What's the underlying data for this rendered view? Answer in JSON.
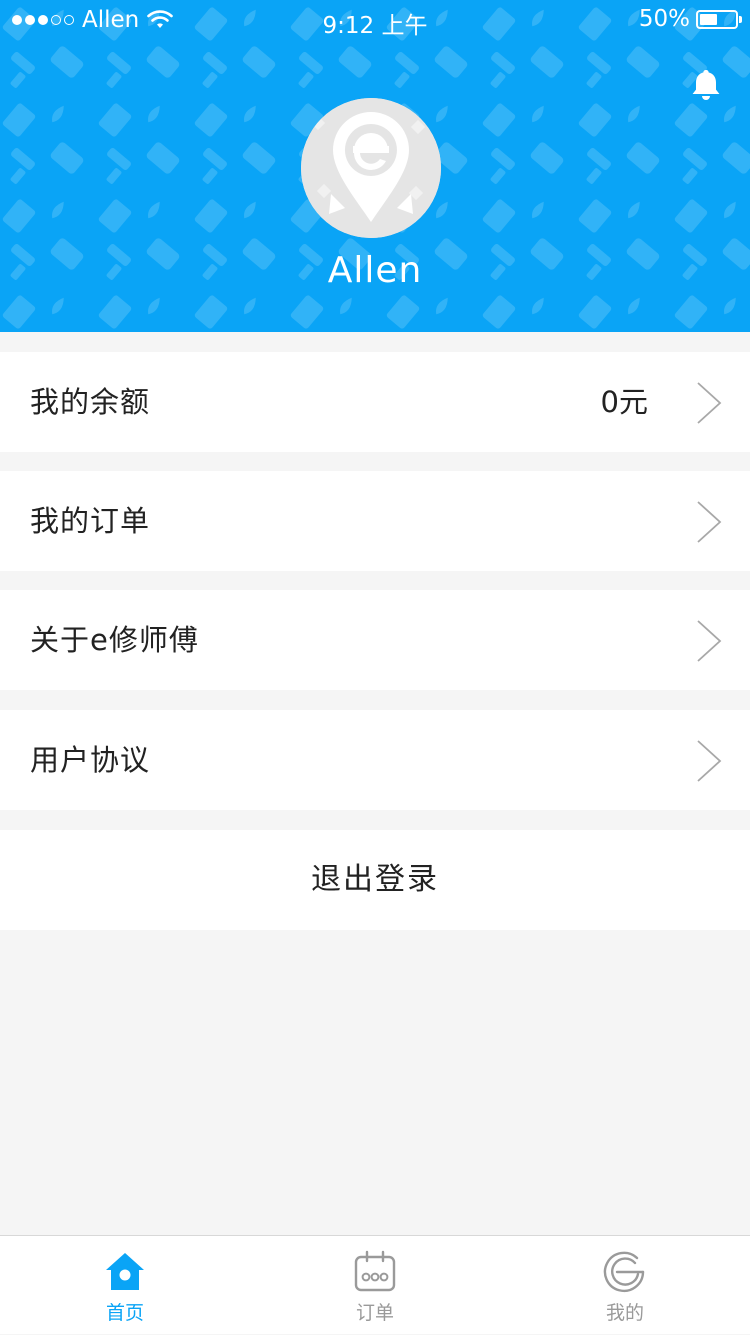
{
  "status_bar": {
    "carrier": "Allen",
    "time": "9:12 上午",
    "battery_text": "50%",
    "battery_level": 0.5
  },
  "header": {
    "username": "Allen",
    "bell_icon": "bell-icon",
    "avatar_icon": "e-map-pin-logo-icon"
  },
  "menu": {
    "items": [
      {
        "label": "我的余额",
        "value": "0元"
      },
      {
        "label": "我的订单"
      },
      {
        "label": "关于e修师傅"
      },
      {
        "label": "用户协议"
      }
    ],
    "logout_label": "退出登录"
  },
  "tabbar": {
    "tabs": [
      {
        "label": "首页",
        "icon": "home-icon",
        "active": true
      },
      {
        "label": "订单",
        "icon": "calendar-icon",
        "active": false
      },
      {
        "label": "我的",
        "icon": "e-logo-icon",
        "active": false
      }
    ]
  },
  "colors": {
    "brand_blue": "#0aa4f6",
    "background": "#f5f5f5",
    "tab_inactive": "#9a9a9a"
  }
}
